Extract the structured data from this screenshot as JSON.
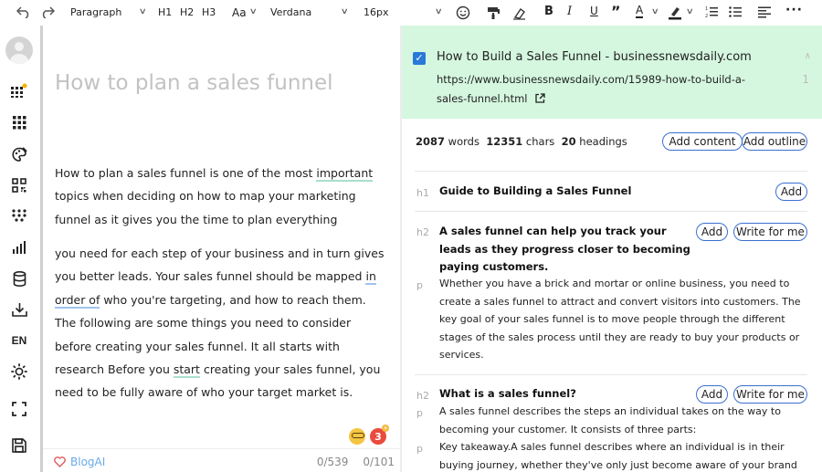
{
  "toolbar": {
    "paragraph_label": "Paragraph",
    "h1": "H1",
    "h2": "H2",
    "h3": "H3",
    "font_size_toggle": "Aa",
    "font_family": "Verdana",
    "font_size": "16px"
  },
  "sidebar": {
    "lang": "EN",
    "icons": [
      "apps-icon",
      "grid-icon",
      "palette-icon",
      "blocks-icon",
      "dots-grid-icon",
      "bar-chart-icon",
      "database-icon",
      "download-icon",
      "language-icon",
      "sun-icon",
      "fullscreen-icon",
      "save-icon"
    ]
  },
  "editor": {
    "title_placeholder": "How to plan a sales funnel",
    "para1": {
      "t1": "How to plan a sales funnel is one of the most ",
      "u1": "important",
      "t2": " topics when deciding on how to map your marketing funnel as it gives you the time to plan everything"
    },
    "para2": {
      "t1": "you need for each step of your business and in turn gives you better leads. Your sales funnel should be mapped ",
      "u1": "in order of",
      "t2": " who you're targeting, and how to reach them. The following are some things you need to consider before creating your sales funnel. It all starts with research Before you ",
      "u2": "start",
      "t3": " creating your sales funnel, you need to be fully aware of who your target market is."
    },
    "footer": {
      "brand": "BlogAI",
      "word_count": "0/539",
      "heading_count": "0/101"
    },
    "notification_count": "3"
  },
  "source": {
    "title": "How to Build a Sales Funnel - businessnewsdaily.com",
    "url": "https://www.businessnewsdaily.com/15989-how-to-build-a-sales-funnel.html",
    "index": "1",
    "stats": {
      "words_value": "2087",
      "words_label": "words",
      "chars_value": "12351",
      "chars_label": "chars",
      "headings_value": "20",
      "headings_label": "headings"
    },
    "add_content": "Add content",
    "add_outline": "Add outline",
    "add": "Add",
    "write_for_me": "Write for me",
    "outline": [
      {
        "tag": "h1",
        "text": "Guide to Building a Sales Funnel"
      },
      {
        "tag": "h2",
        "text": "A sales funnel can help you track your leads as they progress closer to becoming paying customers."
      },
      {
        "tag": "p",
        "text": "Whether you have a brick and mortar or online business, you need to create a sales funnel to attract and convert visitors into customers. The key goal of your sales funnel is to move people through the different stages of the sales process until they are ready to buy your products or services."
      },
      {
        "tag": "h2",
        "text": "What is a sales funnel?"
      },
      {
        "tag": "p",
        "text": "A sales funnel describes the steps an individual takes on the way to becoming your customer. It consists of three parts:"
      },
      {
        "tag": "p",
        "text": "Key takeaway.A sales funnel describes where an individual is in their buying journey, whether they've only just become aware of your brand or"
      }
    ]
  },
  "colors": {
    "accent": "#2979d8",
    "source_card_bg": "#d5f7df",
    "pill_border": "#3b6fd1",
    "brand": "#6aa9e6"
  }
}
